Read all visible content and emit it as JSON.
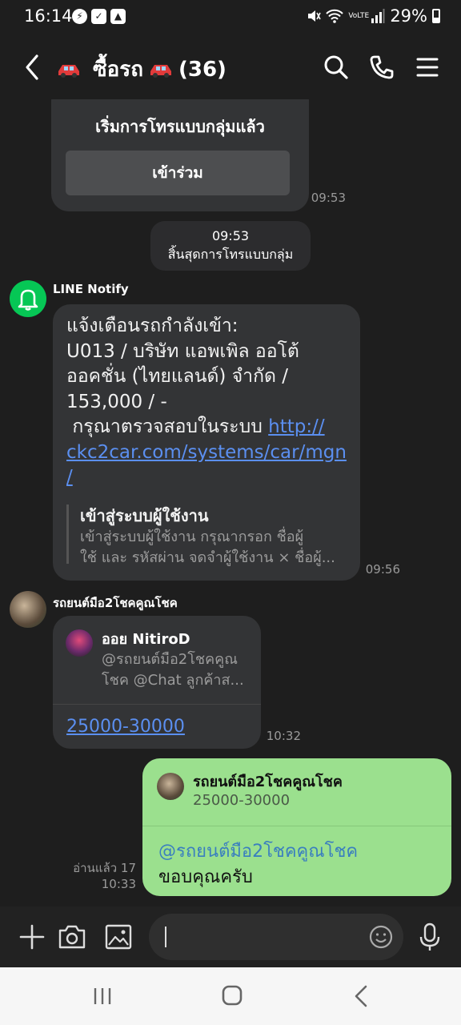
{
  "status_bar": {
    "time": "16:14",
    "signal_small": "VoLTE",
    "battery": "29%"
  },
  "header": {
    "title_prefix": "ซื้อรถ",
    "member_count": "(36)"
  },
  "messages": {
    "call_card": {
      "text": "เริ่มการโทรแบบกลุ่มแล้ว",
      "join_label": "เข้าร่วม",
      "time": "09:53"
    },
    "call_end": {
      "time": "09:53",
      "text": "สิ้นสุดการโทรแบบกลุ่ม"
    },
    "notify": {
      "sender": "LINE Notify",
      "body": "แจ้งเตือนรถกำลังเข้า:\nU013 / บริษัท แอพเพิล ออโต้\nออคชั่น (ไทยแลนด์) จำกัด /\n153,000 / -\n กรุณาตรวจสอบในระบบ ",
      "link": "http://ckc2car.com/systems/car/mgn/",
      "link_display": "http://\nckc2car.com/systems/car/mgn\n/",
      "preview_title": "เข้าสู่ระบบผู้ใช้งาน",
      "preview_desc_1": "เข้าสู่ระบบผู้ใช้งาน กรุณากรอก ชื่อผู้",
      "preview_desc_2": "ใช้ และ รหัสผ่าน จดจำผู้ใช้งาน × ชื่อผู้...",
      "time": "09:56"
    },
    "quote_reply": {
      "sender": "รถยนต์มือ2โชคคูณโชค",
      "quoted_name": "ออย NitiroD",
      "quoted_text_1": "@รถยนต์มือ2โชคคูณ",
      "quoted_text_2": "โชค @Chat ลูกค้าส...",
      "text": "25000-30000",
      "time": "10:32"
    },
    "my_message": {
      "reply_to_name": "รถยนต์มือ2โชคคูณโชค",
      "reply_to_text": "25000-30000",
      "mention": "@รถยนต์มือ2โชคคูณโชค",
      "text": "ขอบคุณครับ",
      "read_status": "อ่านแล้ว 17",
      "time": "10:33"
    }
  },
  "input": {
    "placeholder": ""
  },
  "colors": {
    "background": "#1e1e1e",
    "bubble": "#333436",
    "my_bubble": "#9be08e",
    "link": "#5b8ff0",
    "line_green": "#06c755"
  }
}
